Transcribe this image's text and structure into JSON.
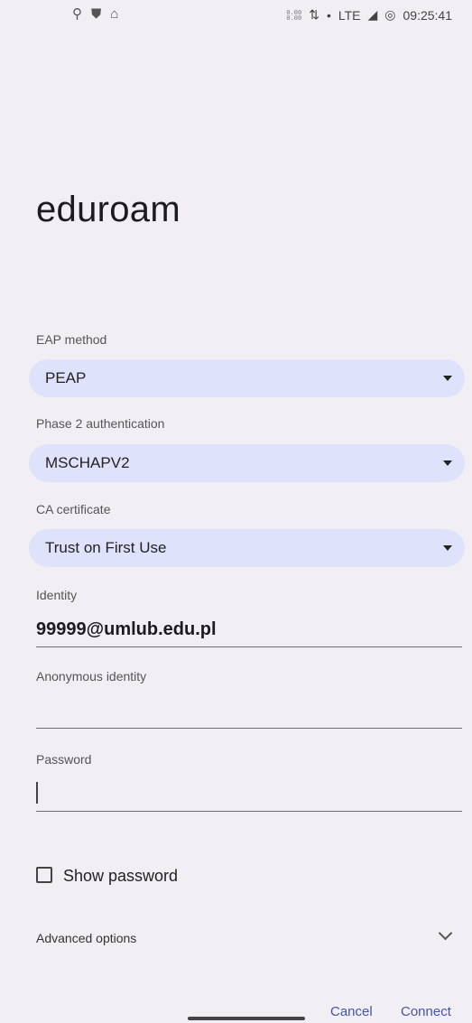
{
  "status_bar": {
    "time": "09:25:41",
    "network": "LTE",
    "speed_top": "0.00",
    "speed_bottom": "0.00",
    "dot": "•"
  },
  "dialog": {
    "title": "eduroam",
    "eap_method": {
      "label": "EAP method",
      "value": "PEAP"
    },
    "phase2": {
      "label": "Phase 2 authentication",
      "value": "MSCHAPV2"
    },
    "ca_cert": {
      "label": "CA certificate",
      "value": "Trust on First Use"
    },
    "identity": {
      "label": "Identity",
      "value": "99999@umlub.edu.pl"
    },
    "anonymous_identity": {
      "label": "Anonymous identity",
      "value": ""
    },
    "password": {
      "label": "Password",
      "value": ""
    },
    "show_password": {
      "label": "Show password",
      "checked": false
    },
    "advanced": {
      "label": "Advanced options"
    },
    "cancel_label": "Cancel",
    "connect_label": "Connect"
  }
}
